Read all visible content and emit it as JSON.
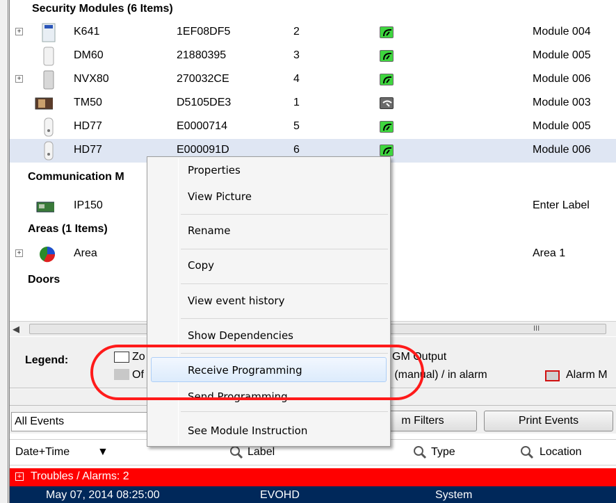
{
  "tree": {
    "security_header": "Security Modules  (6 Items)",
    "security_rows": [
      {
        "name": "K641",
        "serial": "1EF08DF5",
        "num": "2",
        "label": "Module 004",
        "expandable": true,
        "status": "online"
      },
      {
        "name": "DM60",
        "serial": "21880395",
        "num": "3",
        "label": "Module 005",
        "expandable": false,
        "status": "online"
      },
      {
        "name": "NVX80",
        "serial": "270032CE",
        "num": "4",
        "label": "Module 006",
        "expandable": true,
        "status": "online"
      },
      {
        "name": "TM50",
        "serial": "D5105DE3",
        "num": "1",
        "label": "Module 003",
        "expandable": false,
        "status": "offline"
      },
      {
        "name": "HD77",
        "serial": "E0000714",
        "num": "5",
        "label": "Module 005",
        "expandable": false,
        "status": "online"
      },
      {
        "name": "HD77",
        "serial": "E000091D",
        "num": "6",
        "label": "Module 006",
        "expandable": false,
        "status": "online"
      }
    ],
    "comm_header": "Communication M",
    "comm_rows": [
      {
        "name": "IP150",
        "label": "Enter Label"
      }
    ],
    "areas_header": "Areas (1 Items)",
    "area_rows": [
      {
        "name": "Area",
        "label": "Area 1"
      }
    ],
    "doors_header": "Doors"
  },
  "scrollbar": {
    "grip": "III"
  },
  "legend": {
    "title": "Legend:",
    "item1_fragment": "Zo",
    "item2_fragment": "Of",
    "pgm_output": "GM Output",
    "in_alarm": "n (manual) / in alarm",
    "alarm_fragment": "Alarm M"
  },
  "toolbar": {
    "events_filter": "All Events",
    "filters_btn": "m Filters",
    "print_btn": "Print Events"
  },
  "columns": {
    "datetime": "Date+Time",
    "sort_arrow": "▼",
    "label": "Label",
    "type": "Type",
    "location": "Location"
  },
  "events": {
    "trouble_row": "Troubles / Alarms: 2",
    "rows": [
      {
        "datetime": "May 07, 2014  08:25:00",
        "label": "EVOHD",
        "type": "System"
      }
    ]
  },
  "context_menu": {
    "items": [
      "Properties",
      "View Picture",
      "Rename",
      "Copy",
      "View event history",
      "Show Dependencies",
      "Receive Programming",
      "Send Programming",
      "See Module Instruction"
    ],
    "highlighted": "Receive Programming"
  },
  "colors": {
    "online": "#3ed63e",
    "offline": "#6a6a6a",
    "trouble_bg": "#ff0000",
    "event_bg": "#00285a",
    "annotation": "#ff1a1a"
  }
}
